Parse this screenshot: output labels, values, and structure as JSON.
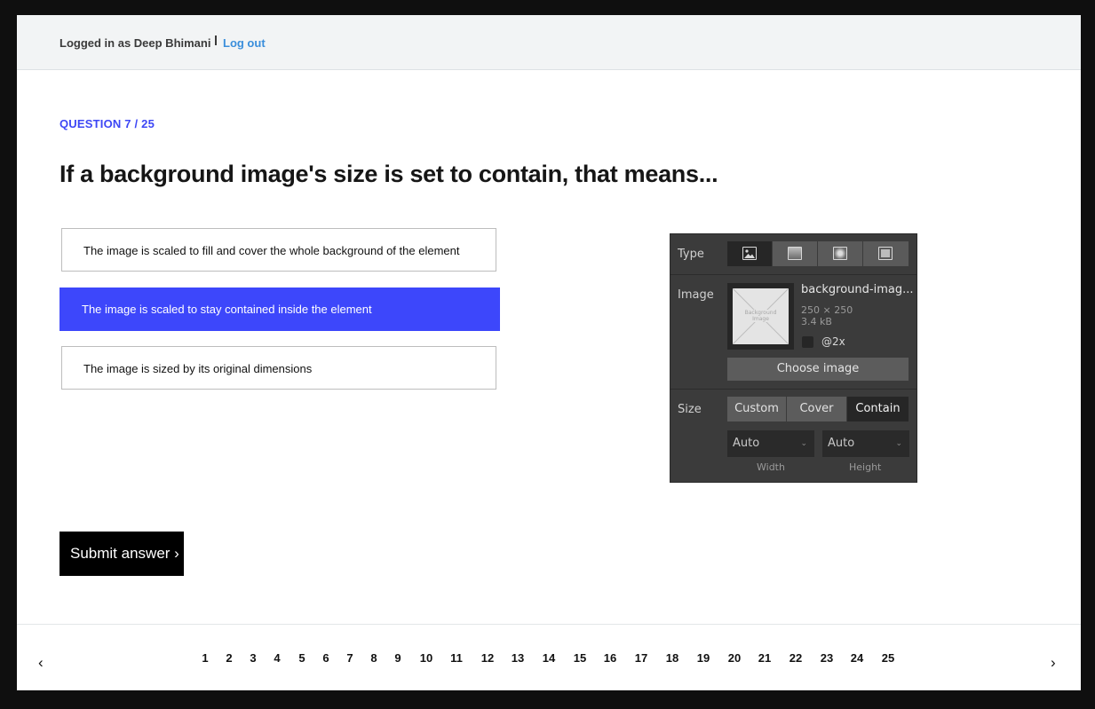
{
  "header": {
    "logged_in_text": "Logged in as Deep Bhimani",
    "logout_label": "Log out"
  },
  "question": {
    "number_label": "QUESTION 7 / 25",
    "title": "If a background image's size is set to contain, that means..."
  },
  "options": [
    {
      "text": "The image is scaled to fill and cover the whole background of the element",
      "selected": false
    },
    {
      "text": "The image is scaled to stay contained inside the element",
      "selected": true
    },
    {
      "text": "The image is sized by its original dimensions",
      "selected": false
    }
  ],
  "panel": {
    "type_label": "Type",
    "type_options": [
      "image-icon",
      "linear-gradient-icon",
      "radial-gradient-icon",
      "solid-color-icon"
    ],
    "image_label": "Image",
    "thumbnail_text": "Background Image",
    "file_name": "background-imag...",
    "dimensions": "250 × 250",
    "file_size": "3.4 kB",
    "retina_label": "@2x",
    "choose_button": "Choose image",
    "size_label": "Size",
    "size_options": [
      "Custom",
      "Cover",
      "Contain"
    ],
    "size_selected": "Contain",
    "width_value": "Auto",
    "height_value": "Auto",
    "width_label": "Width",
    "height_label": "Height"
  },
  "submit_label": "Submit answer ›",
  "pagination": {
    "prev": "‹",
    "next": "›",
    "pages": [
      "1",
      "2",
      "3",
      "4",
      "5",
      "6",
      "7",
      "8",
      "9",
      "10",
      "11",
      "12",
      "13",
      "14",
      "15",
      "16",
      "17",
      "18",
      "19",
      "20",
      "21",
      "22",
      "23",
      "24",
      "25"
    ]
  },
  "colors": {
    "accent": "#3d47fb",
    "link": "#3a8edb",
    "page_background": "#0f0f0f",
    "topbar": "#f2f4f5"
  }
}
